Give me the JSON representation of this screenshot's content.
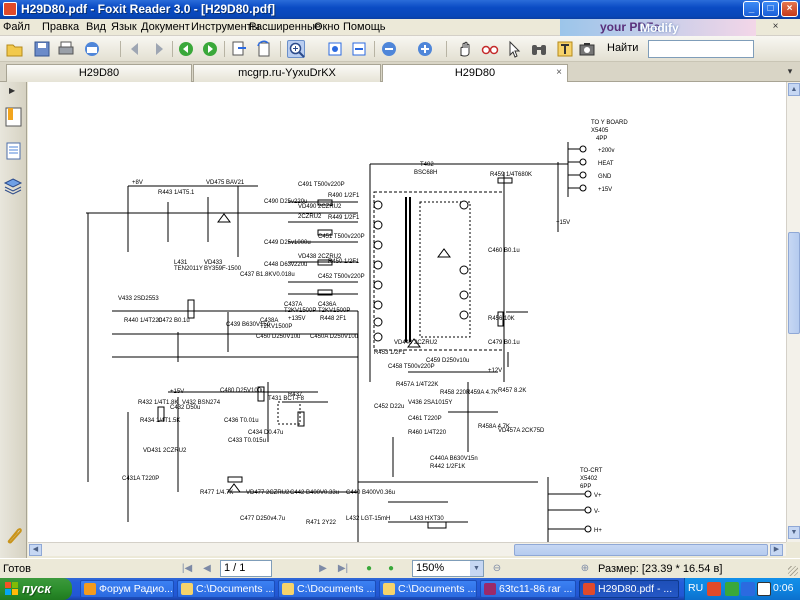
{
  "window": {
    "title": "H29D80.pdf - Foxit Reader 3.0 - [H29D80.pdf]"
  },
  "menu": [
    "Файл",
    "Правка",
    "Вид",
    "Язык",
    "Документ",
    "Инструменты",
    "Расширенные",
    "Окно",
    "Помощь"
  ],
  "promo": {
    "text_a": "Modify",
    "text_b": "your PDFs"
  },
  "toolbar": {
    "find_label": "Найти",
    "find_placeholder": "",
    "icons": [
      "open-icon",
      "save-icon",
      "print-icon",
      "email-icon",
      "back-icon",
      "forward-icon",
      "prev-view-icon",
      "next-view-icon",
      "extract-icon",
      "rotate-icon",
      "zoom-in-tool-icon",
      "fit-page-icon",
      "fit-width-icon",
      "zoom-out-icon",
      "zoom-plus-icon",
      "hand-icon",
      "glasses-icon",
      "select-icon",
      "binoculars-icon",
      "text-select-icon",
      "snapshot-icon"
    ]
  },
  "tabs": [
    {
      "label": "H29D80",
      "active": false
    },
    {
      "label": "mcgrp.ru-YyxuDrKX",
      "active": false
    },
    {
      "label": "H29D80",
      "active": true
    }
  ],
  "schematic": {
    "connector_y": {
      "title": "TO Y BOARD",
      "ref": "X5405",
      "pins": "4PP"
    },
    "rail_labels": [
      "+200v",
      "HEAT",
      "GND",
      "+15V"
    ],
    "plus15v": "+15V",
    "plus8v": "+8V",
    "plus15v_b": "+15V",
    "plus12v": "+12V",
    "transformer": {
      "ref": "T402",
      "type": "BSC68H"
    },
    "to_crt": {
      "title": "TO-CRT",
      "ref": "X5402",
      "pins": "6PP"
    },
    "crt_pins": [
      "V+",
      "V-",
      "H+"
    ],
    "labels": [
      "C491 T500v220P",
      "VD490 2CZRU2",
      "R490 1/2F1",
      "C490 D25v220u",
      "2CZRU2",
      "R449 1/2F1",
      "C449 D25v1000u",
      "C451 T500v220P",
      "VD438 2CZRU2",
      "R450 1/2F1",
      "C448 D63v220u",
      "C452 T500v220P",
      "R459 1/4T680K",
      "VD475 BAV21",
      "R443 1/4T5.1",
      "L431",
      "VD433",
      "TEN2011Y",
      "BY359F-1500",
      "C437 B1.8KV0.018u",
      "V433 2SD2553",
      "C437A",
      "C436A",
      "T2KV1500P",
      "T2KV1500P",
      "R440 1/4T220",
      "C472 B0.1u",
      "C439 B630V15n",
      "C438A",
      "T2KV1500P",
      "C450 D250V10u",
      "C450A D250V10u",
      "R448 2F1",
      "+135V",
      "C460 B0.1u",
      "R456 10K",
      "C479 B0.1u",
      "VD440 2CZRU2",
      "C458 T500v220P",
      "C459 D250v10u",
      "R453 1/2F1",
      "R457A 1/4T22K",
      "R458 220K",
      "R459A 4.7K",
      "R457 8.2K",
      "V436 2SA1015Y",
      "C452 D22u",
      "C461 T220P",
      "R460 1/4T220",
      "R458A 4.7K",
      "VD457A 2CK75D",
      "C480 D25V100u",
      "V432 BSN274",
      "R432 1/4T1.8K",
      "C432 D50u",
      "R434 1/4T1.5K",
      "VD431 2CZRU2",
      "T431 BCT-F8",
      "R437",
      "C436 T0.01u",
      "C434 D0.47u",
      "C433 T0.015u",
      "C431A T220P",
      "R477 1/4.7K",
      "VD477 2CZRU2",
      "C442 B400V0.33u",
      "C477 D250v4.7u",
      "C440 B400V0.36u",
      "L432 LGT-15mH",
      "L433 HXT30",
      "C440A B630V15n",
      "R442 1/2F1K",
      "R471 2Y22"
    ]
  },
  "statusbar": {
    "ready": "Готов",
    "page": "1 / 1",
    "zoom": "150%",
    "size": "Размер: [23.39 * 16.54 в]"
  },
  "taskbar": {
    "start": "пуск",
    "tasks": [
      {
        "label": "Форум Радио...",
        "color": "#f39b1e"
      },
      {
        "label": "C:\\Documents ...",
        "color": "#f6d36b"
      },
      {
        "label": "C:\\Documents ...",
        "color": "#f6d36b"
      },
      {
        "label": "C:\\Documents ...",
        "color": "#f6d36b"
      },
      {
        "label": "63tc11-86.rar ...",
        "color": "#9b2a6a"
      },
      {
        "label": "H29D80.pdf - ...",
        "color": "#e14a2a"
      }
    ],
    "lang": "RU",
    "clock": "0:06"
  }
}
